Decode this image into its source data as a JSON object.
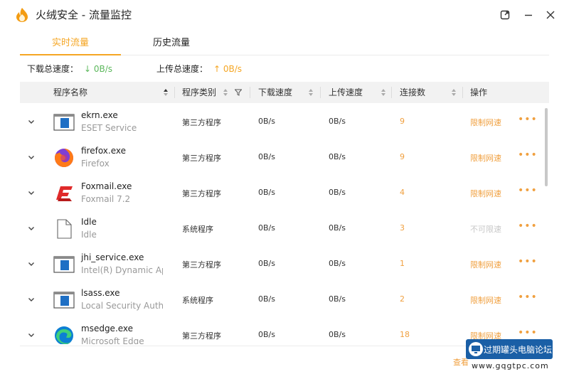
{
  "window": {
    "title": "火绒安全 - 流量监控",
    "logo_icon": "huorong-flame-icon",
    "buttons": [
      "pin-window-icon",
      "minimize-icon",
      "close-icon"
    ]
  },
  "tabs": [
    {
      "label": "实时流量",
      "active": true
    },
    {
      "label": "历史流量",
      "active": false
    }
  ],
  "summary": {
    "download_label": "下载总速度：",
    "download_value": "↓ 0B/s",
    "upload_label": "上传总速度：",
    "upload_value": "↑ 0B/s"
  },
  "table": {
    "headers": {
      "name": "程序名称",
      "type": "程序类别",
      "down": "下载速度",
      "up": "上传速度",
      "conn": "连接数",
      "action": "操作"
    },
    "rows": [
      {
        "name": "ekrn.exe",
        "desc": "ESET Service",
        "type": "第三方程序",
        "down": "0B/s",
        "up": "0B/s",
        "conn": "9",
        "limit": "限制网速",
        "limit_enabled": true,
        "icon": "window-app-icon"
      },
      {
        "name": "firefox.exe",
        "desc": "Firefox",
        "type": "第三方程序",
        "down": "0B/s",
        "up": "0B/s",
        "conn": "9",
        "limit": "限制网速",
        "limit_enabled": true,
        "icon": "firefox-icon"
      },
      {
        "name": "Foxmail.exe",
        "desc": "Foxmail 7.2",
        "type": "第三方程序",
        "down": "0B/s",
        "up": "0B/s",
        "conn": "4",
        "limit": "限制网速",
        "limit_enabled": true,
        "icon": "foxmail-icon"
      },
      {
        "name": "Idle",
        "desc": "Idle",
        "type": "系统程序",
        "down": "0B/s",
        "up": "0B/s",
        "conn": "3",
        "limit": "不可限速",
        "limit_enabled": false,
        "icon": "blank-file-icon"
      },
      {
        "name": "jhi_service.exe",
        "desc": "Intel(R) Dynamic Ap...",
        "type": "第三方程序",
        "down": "0B/s",
        "up": "0B/s",
        "conn": "1",
        "limit": "限制网速",
        "limit_enabled": true,
        "icon": "window-app-icon"
      },
      {
        "name": "lsass.exe",
        "desc": "Local Security Auth...",
        "type": "系统程序",
        "down": "0B/s",
        "up": "0B/s",
        "conn": "2",
        "limit": "限制网速",
        "limit_enabled": true,
        "icon": "window-app-icon"
      },
      {
        "name": "msedge.exe",
        "desc": "Microsoft Edge",
        "type": "第三方程序",
        "down": "0B/s",
        "up": "0B/s",
        "conn": "18",
        "limit": "限制网速",
        "limit_enabled": true,
        "icon": "edge-icon"
      }
    ],
    "more_label": "•••"
  },
  "footer": {
    "view_link": "查看"
  },
  "watermark": {
    "title": "过期罐头电脑论坛",
    "url": "www.gqgtpc.com"
  },
  "colors": {
    "accent": "#f5a623",
    "download": "#5cb85c",
    "disabled": "#c8c8c8"
  }
}
